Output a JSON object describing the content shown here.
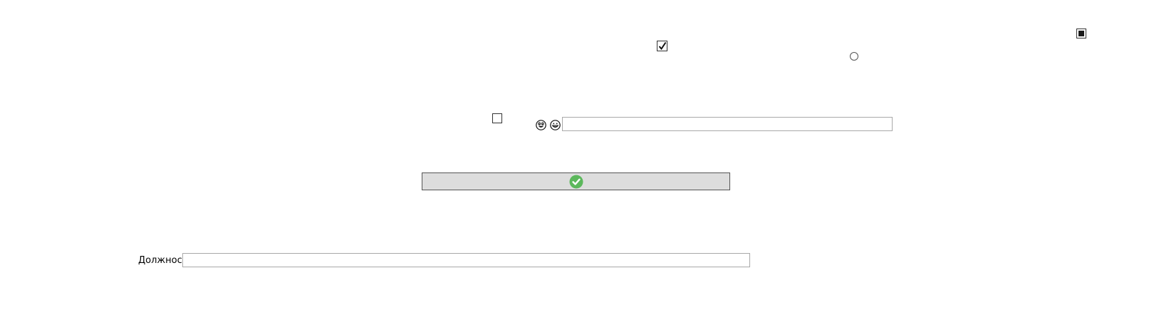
{
  "form": {
    "position_label": "Должность",
    "position_value": "",
    "top_input_value": ""
  },
  "controls": {
    "checkbox_indeterminate": "indeterminate",
    "checkbox_checked": true,
    "radio_selected": false,
    "checkbox_unchecked": false
  },
  "icons": {
    "emoji_1": "grinning-face-with-big-eyes-icon",
    "emoji_2": "grinning-face-icon",
    "confirm": "check-circle-icon"
  },
  "colors": {
    "button_bg": "#dddddd",
    "check_green": "#5cb85c"
  }
}
